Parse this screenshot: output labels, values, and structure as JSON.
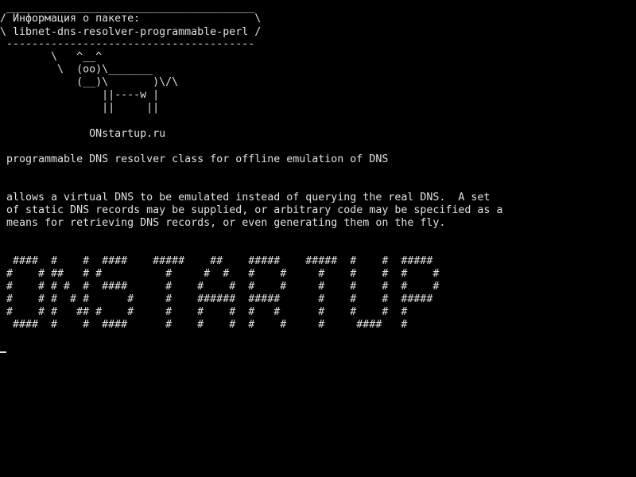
{
  "terminal": {
    "background": "#000000",
    "foreground": "#e0e0e0",
    "cowsay": {
      "bubble": [
        " _______________________________________",
        "/ Информация о пакете:                  \\",
        "\\ libnet-dns-resolver-programmable-perl /",
        " ---------------------------------------",
        "        \\   ^__^",
        "         \\  (oo)\\_______",
        "            (__)\\       )\\/\\",
        "                ||----w |",
        "                ||     ||"
      ],
      "site": "              ONstartup.ru"
    },
    "summary": " programmable DNS resolver class for offline emulation of DNS",
    "description": [
      " allows a virtual DNS to be emulated instead of querying the real DNS.  A set",
      " of static DNS records may be supplied, or arbitrary code may be specified as a",
      " means for retrieving DNS records, or even generating them on the fly."
    ],
    "banner": [
      "  ####  #    #  ####    #####    ##    #####    #####  #    #  #####",
      " #    # ##   # #          #     #  #   #    #     #    #    #  #    #",
      " #    # # #  #  ####      #    #    #  #    #     #    #    #  #    #",
      " #    # #  # #      #     #    ######  #####      #    #    #  #####",
      " #    # #   ## #    #     #    #    #  #   #      #    #    #  #",
      "  ####  #    #  ####      #    #    #  #    #     #     ####   #"
    ]
  }
}
